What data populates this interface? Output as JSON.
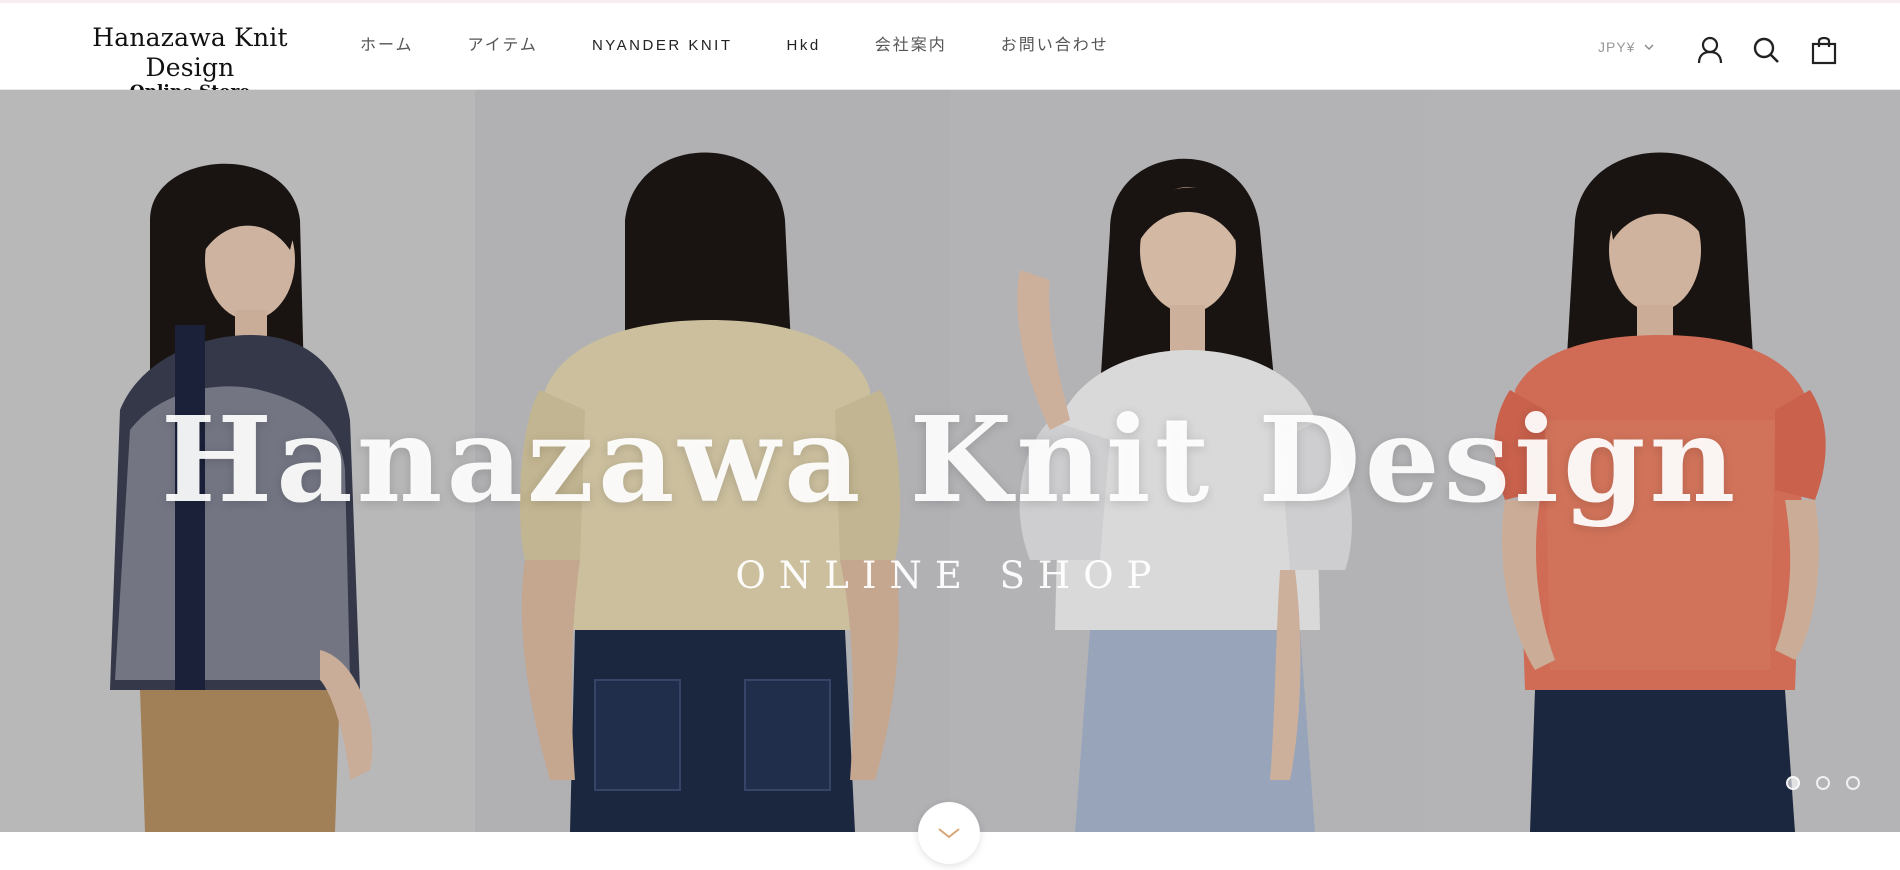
{
  "brand": {
    "logo_line1": "Hanazawa Knit Design",
    "logo_line2": "Online Store"
  },
  "nav": {
    "items": [
      {
        "label": "ホーム",
        "active": true
      },
      {
        "label": "アイテム",
        "active": false
      },
      {
        "label": "NYANDER KNIT",
        "active": false
      },
      {
        "label": "Hkd",
        "active": false
      },
      {
        "label": "会社案内",
        "active": false
      },
      {
        "label": "お問い合わせ",
        "active": false
      }
    ]
  },
  "header": {
    "currency": "JPY¥",
    "icons": [
      "account-icon",
      "search-icon",
      "cart-icon"
    ]
  },
  "hero": {
    "title": "Hanazawa Knit Design",
    "subtitle": "ONLINE SHOP",
    "slides_count": 3,
    "active_slide": 1
  },
  "colors": {
    "hero_background": "#c9c9cb",
    "top_knit_navy": "#2b3348",
    "top_knit_beige": "#e2d5b0",
    "top_knit_white": "#f2f2f2",
    "top_knit_coral": "#e8795f",
    "denim": "#1f2b47",
    "light_blue_pants": "#a9b7cf",
    "khaki_pants": "#b48f62",
    "scroll_arrow": "#d9a574"
  },
  "icons": {
    "scroll": "chevron-down-icon",
    "currency_dropdown": "chevron-down-icon"
  }
}
